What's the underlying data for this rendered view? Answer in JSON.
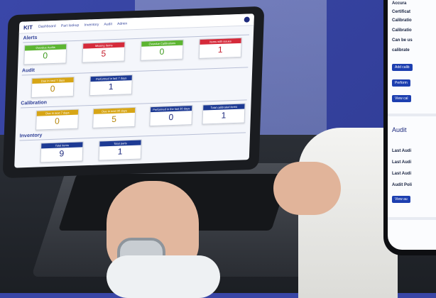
{
  "nav": {
    "logo": "KIT",
    "items": [
      "Dashboard",
      "Part lookup",
      "Inventory",
      "Audit",
      "Admin"
    ]
  },
  "sections": {
    "alerts": "Alerts",
    "audit": "Audit",
    "calibration": "Calibration",
    "inventory": "Inventory"
  },
  "tiles": {
    "alerts_overdue_audits": {
      "label": "Overdue Audits",
      "value": "0"
    },
    "alerts_missing_items": {
      "label": "Missing Items",
      "value": "5"
    },
    "alerts_overdue_calibrations": {
      "label": "Overdue Calibrations",
      "value": "0"
    },
    "alerts_items_with_issues": {
      "label": "Items with issues",
      "value": "1"
    },
    "audit_due_next_7": {
      "label": "Due in next 7 days",
      "value": "0"
    },
    "audit_performed_last_7": {
      "label": "Performed in last 7 days",
      "value": "1"
    },
    "cal_due_next_7": {
      "label": "Due in next 7 days",
      "value": "0"
    },
    "cal_due_next_30": {
      "label": "Due in next 30 days",
      "value": "5"
    },
    "cal_performed_last_30": {
      "label": "Performed in the last 30 days",
      "value": "0"
    },
    "cal_total_calibrated": {
      "label": "Total calibrated items",
      "value": "1"
    },
    "inv_total_items": {
      "label": "Total items",
      "value": "9"
    },
    "inv_total_parts": {
      "label": "Total parts",
      "value": "1"
    }
  },
  "phone": {
    "lines": [
      "Accura",
      "Certificat",
      "Calibratio",
      "Calibratio",
      "Can be us",
      "calibrate"
    ],
    "buttons": [
      "Add calib",
      "Perform",
      "View cal"
    ],
    "audit_title": "Audit",
    "audit_lines": [
      "Last Audi",
      "Last Audi",
      "Last Audi",
      "Audit Poli"
    ],
    "audit_button": "View au"
  }
}
